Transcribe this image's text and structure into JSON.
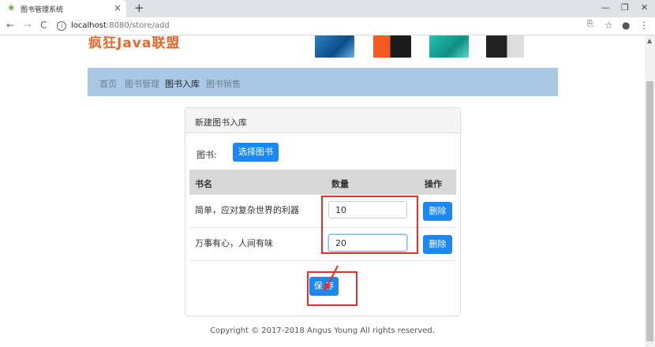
{
  "browser": {
    "tab_title": "图书管理系统",
    "url_host": "localhost",
    "url_rest": ":8080/store/add"
  },
  "site": {
    "logo_text": "疯狂Java联盟"
  },
  "nav": {
    "items": [
      {
        "label": "首页",
        "active": false
      },
      {
        "label": "图书管理",
        "active": false
      },
      {
        "label": "图书入库",
        "active": true
      },
      {
        "label": "图书销售",
        "active": false
      }
    ]
  },
  "panel": {
    "title": "新建图书入库",
    "book_label": "图书:",
    "choose_button": "选择图书",
    "columns": [
      "书名",
      "数量",
      "操作"
    ],
    "rows": [
      {
        "name": "简单，应对复杂世界的利器",
        "quantity": "10",
        "action": "删除"
      },
      {
        "name": "万事有心，人间有味",
        "quantity": "20",
        "action": "删除"
      }
    ],
    "save_button": "保 存"
  },
  "footer": {
    "text": "Copyright © 2017-2018 Angus Young All rights reserved."
  },
  "colors": {
    "primary_button": "#1e88f2",
    "navbar": "#a8c8e6",
    "highlight": "#e53030",
    "logo": "#e8672b"
  }
}
